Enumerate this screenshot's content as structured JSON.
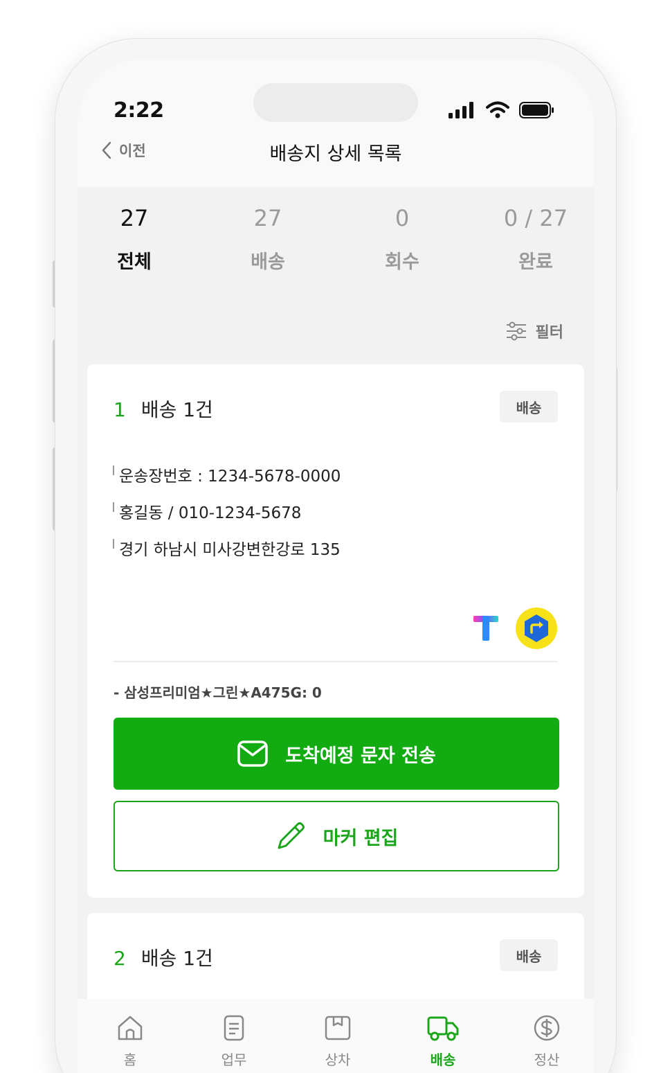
{
  "status_bar": {
    "time": "2:22"
  },
  "nav": {
    "back_label": "이전",
    "title": "배송지 상세 목록"
  },
  "stats": [
    {
      "value": "27",
      "label": "전체",
      "active": true
    },
    {
      "value": "27",
      "label": "배송",
      "active": false
    },
    {
      "value": "0",
      "label": "회수",
      "active": false
    },
    {
      "value": "0 / 27",
      "label": "완료",
      "active": false
    }
  ],
  "filter": {
    "label": "필터"
  },
  "cards": [
    {
      "index": "1",
      "title": "배송 1건",
      "badge": "배송",
      "lines": [
        "운송장번호 : 1234-5678-0000",
        "홍길동 / 010-1234-5678",
        "경기 하남시 미사강변한강로 135"
      ],
      "product": "- 삼성프리미엄★그린★A475G: 0",
      "primary_button": "도착예정 문자 전송",
      "secondary_button": "마커 편집"
    },
    {
      "index": "2",
      "title": "배송 1건",
      "badge": "배송"
    }
  ],
  "tabs": [
    {
      "label": "홈",
      "icon": "home-icon"
    },
    {
      "label": "업무",
      "icon": "document-icon"
    },
    {
      "label": "상차",
      "icon": "box-icon"
    },
    {
      "label": "배송",
      "icon": "truck-icon",
      "active": true
    },
    {
      "label": "정산",
      "icon": "dollar-icon"
    }
  ],
  "colors": {
    "accent": "#12AB12",
    "accent_text": "#1AA51A",
    "muted": "#9A9A9A"
  }
}
